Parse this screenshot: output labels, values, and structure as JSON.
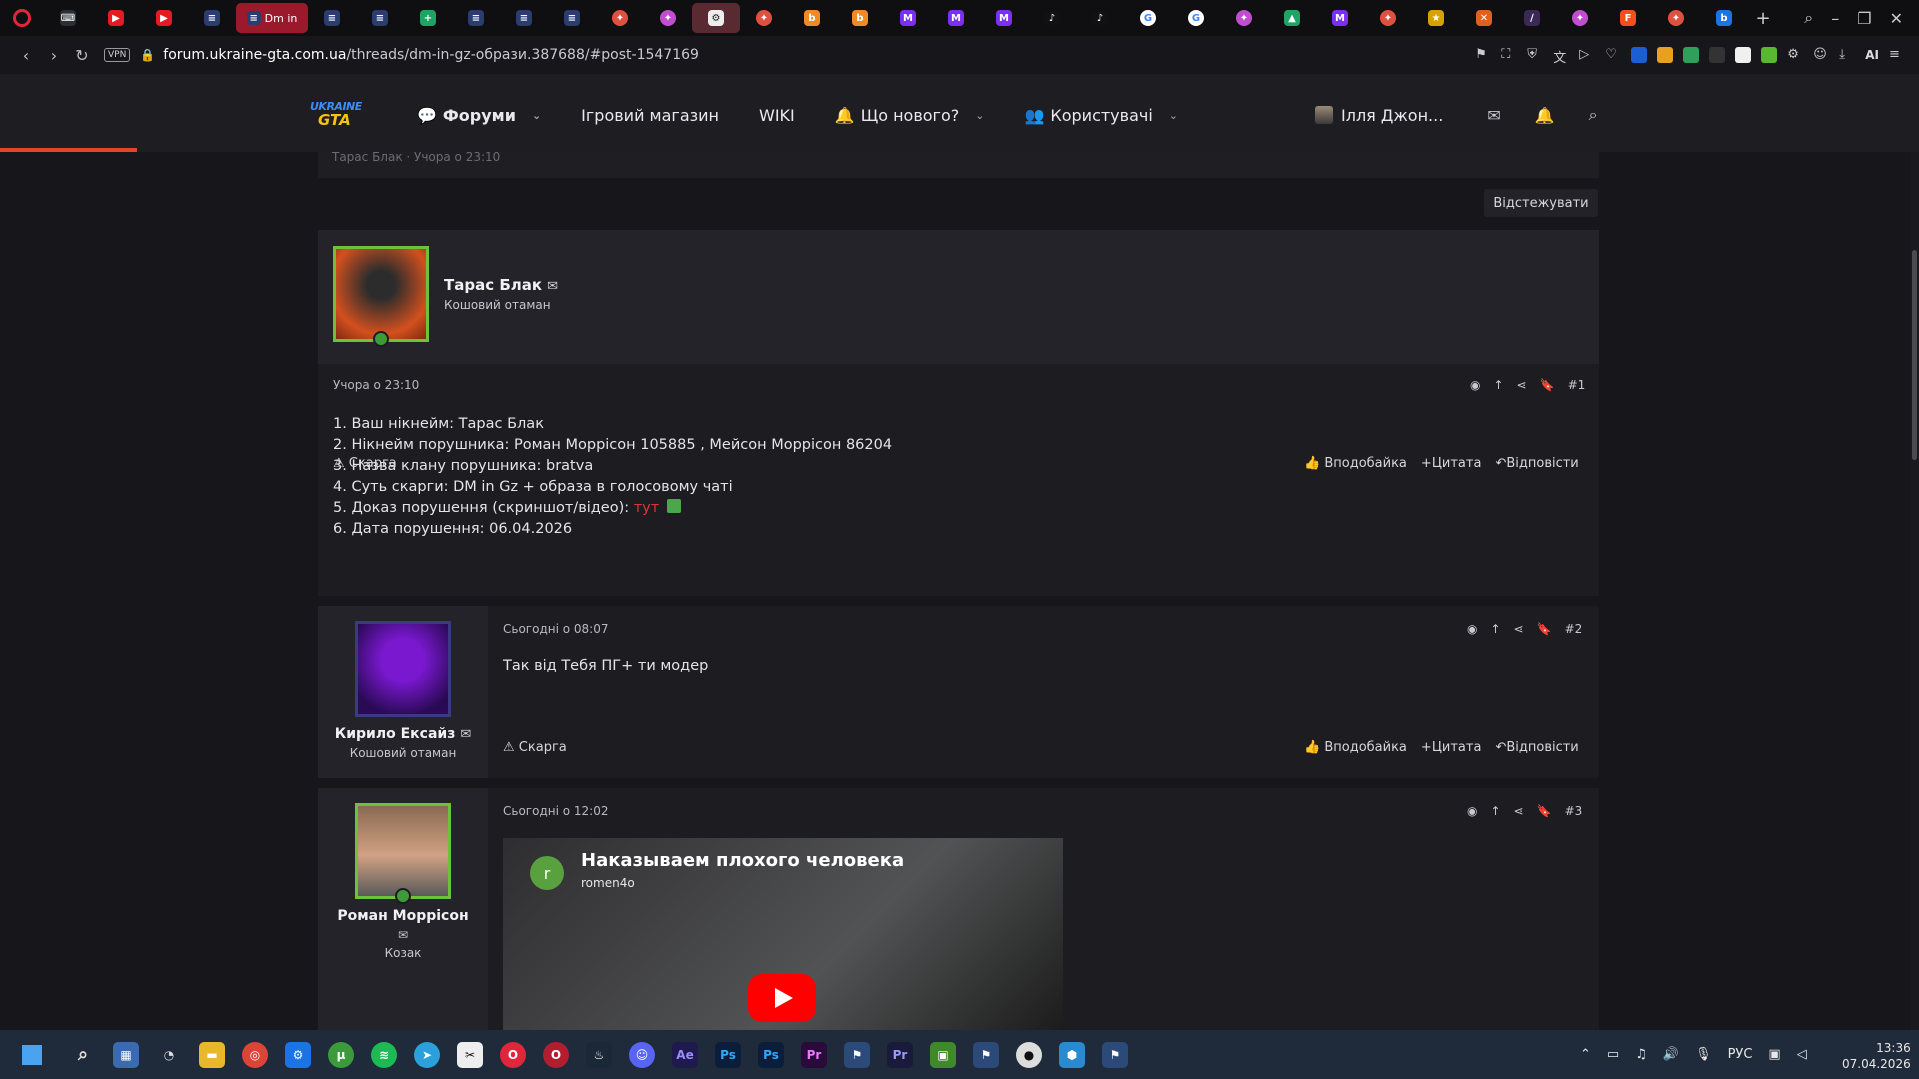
{
  "browser": {
    "active_tab_title": "Dm in",
    "new_tab_symbol": "+",
    "url_domain": "forum.ukraine-gta.com.ua",
    "url_path": "/threads/dm-in-gz-образи.387688/#post-1547169",
    "vpn_label": "VPN",
    "ai_label": "AI"
  },
  "site": {
    "logo_top": "UKRAINE",
    "logo_bottom": "GTA",
    "nav": {
      "forums": "Форуми",
      "store": "Ігровий магазин",
      "wiki": "WIKI",
      "whats_new": "Що нового?",
      "users": "Користувачі"
    },
    "user_name": "Ілля Джон..."
  },
  "thread": {
    "prev_strip_text": "Тарас Блак · Учора о 23:10",
    "follow_label": "Відстежувати",
    "posts": [
      {
        "author": "Тарас Блак",
        "role": "Кошовий отаман",
        "date": "Учора о 23:10",
        "number": "#1",
        "lines": [
          "1. Ваш нікнейм: Тарас Блак",
          "2. Нікнейм порушника: Роман Моррісон 105885 , Мейсон Моррісон 86204",
          "3. Назва клану порушника: bratva",
          "4. Суть скарги: DM in Gz + образа в голосовому чаті",
          "5. Доказ порушення (скриншот/відео): ",
          "6. Дата порушення: 06.04.2026"
        ],
        "link_text": "тут"
      },
      {
        "author": "Кирило Ексайз",
        "role": "Кошовий отаман",
        "date": "Сьогодні о 08:07",
        "number": "#2",
        "text": "Так від Тебя ПГ+ ти модер"
      },
      {
        "author": "Роман Моррісон",
        "role": "Козак",
        "date": "Сьогодні о 12:02",
        "number": "#3",
        "video": {
          "badge_letter": "r",
          "title": "Наказываем плохого человека",
          "channel": "romen4o"
        }
      }
    ],
    "report_label": "Скарга",
    "like_label": "Вподобайка",
    "quote_label": "Цитата",
    "reply_label": "Відповісти"
  },
  "taskbar": {
    "lang": "РУС",
    "time": "13:36",
    "date": "07.04.2026"
  },
  "colors": {
    "accent_red": "#e0263a",
    "online_green": "#3d9b39",
    "load_bar": "#e2442c"
  }
}
